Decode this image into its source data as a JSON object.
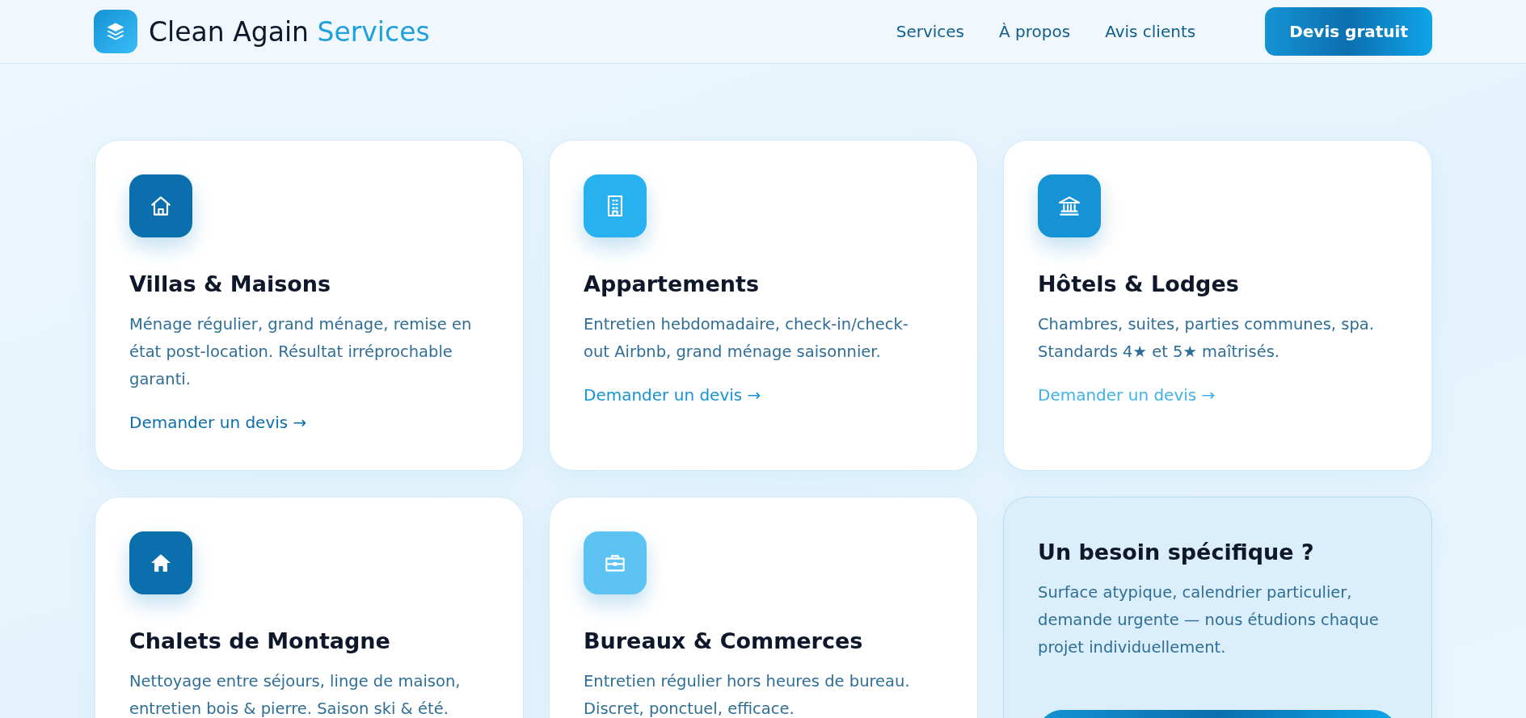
{
  "header": {
    "brand": {
      "name": "Clean Again",
      "accent": "Services"
    },
    "nav": [
      {
        "label": "Services"
      },
      {
        "label": "À propos"
      },
      {
        "label": "Avis clients"
      }
    ],
    "cta": "Devis gratuit"
  },
  "cards": [
    {
      "kind": "service",
      "color": "#0b6fae",
      "title": "Villas & Maisons",
      "text": "Ménage régulier, grand ménage, remise en état post-location. Résultat irréprochable garanti.",
      "link": "Demander un devis →"
    },
    {
      "kind": "service",
      "color": "#27b1ee",
      "title": "Appartements",
      "text": "Entretien hebdomadaire, check-in/check-out Airbnb, grand ménage saisonnier.",
      "link": "Demander un devis →"
    },
    {
      "kind": "service",
      "color": "#1593d4",
      "title": "Hôtels & Lodges",
      "text": "Chambres, suites, parties communes, spa. Standards 4★ et 5★ maîtrisés.",
      "link": "Demander un devis →"
    },
    {
      "kind": "service",
      "color": "#0b6fae",
      "title": "Chalets de Montagne",
      "text": "Nettoyage entre séjours, linge de maison, entretien bois & pierre. Saison ski & été."
    },
    {
      "kind": "service",
      "color": "#5cc3f2",
      "title": "Bureaux & Commerces",
      "text": "Entretien régulier hors heures de bureau. Discret, ponctuel, efficace."
    },
    {
      "kind": "custom",
      "title": "Un besoin spécifique ?",
      "text": "Surface atypique, calendrier particulier, demande urgente — nous étudions chaque projet individuellement."
    }
  ]
}
